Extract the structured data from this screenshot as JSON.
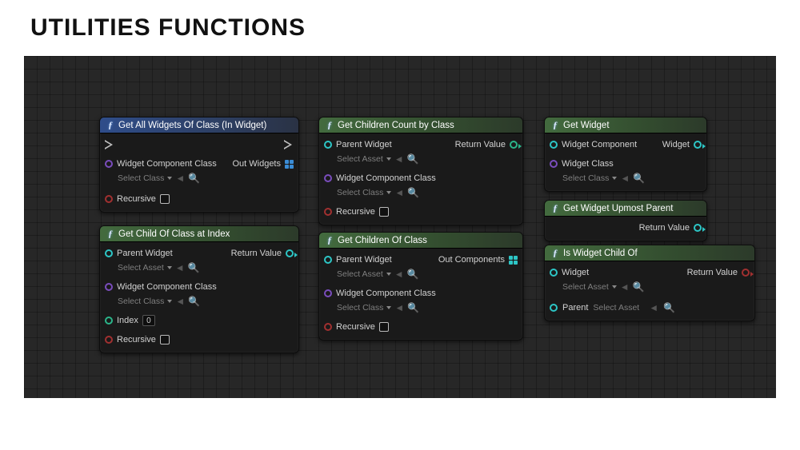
{
  "title": "UTILITIES FUNCTIONS",
  "common": {
    "select_class": "Select Class",
    "select_asset": "Select Asset",
    "return_value": "Return Value"
  },
  "nodes": {
    "n1": {
      "title": "Get All Widgets Of Class (In Widget)",
      "p_class": "Widget Component Class",
      "p_recursive": "Recursive",
      "out": "Out Widgets"
    },
    "n2": {
      "title": "Get Child Of Class at Index",
      "p_parent": "Parent Widget",
      "p_class": "Widget Component Class",
      "p_index": "Index",
      "index_val": "0",
      "p_recursive": "Recursive"
    },
    "n3": {
      "title": "Get Children Count by Class",
      "p_parent": "Parent Widget",
      "p_class": "Widget Component Class",
      "p_recursive": "Recursive"
    },
    "n4": {
      "title": "Get Children Of Class",
      "p_parent": "Parent Widget",
      "p_class": "Widget Component Class",
      "p_recursive": "Recursive",
      "out": "Out Components"
    },
    "n5": {
      "title": "Get Widget",
      "p_comp": "Widget Component",
      "p_class": "Widget Class",
      "out": "Widget"
    },
    "n6": {
      "title": "Get Widget Upmost Parent"
    },
    "n7": {
      "title": "Is Widget Child Of",
      "p_widget": "Widget",
      "p_parent": "Parent"
    }
  }
}
